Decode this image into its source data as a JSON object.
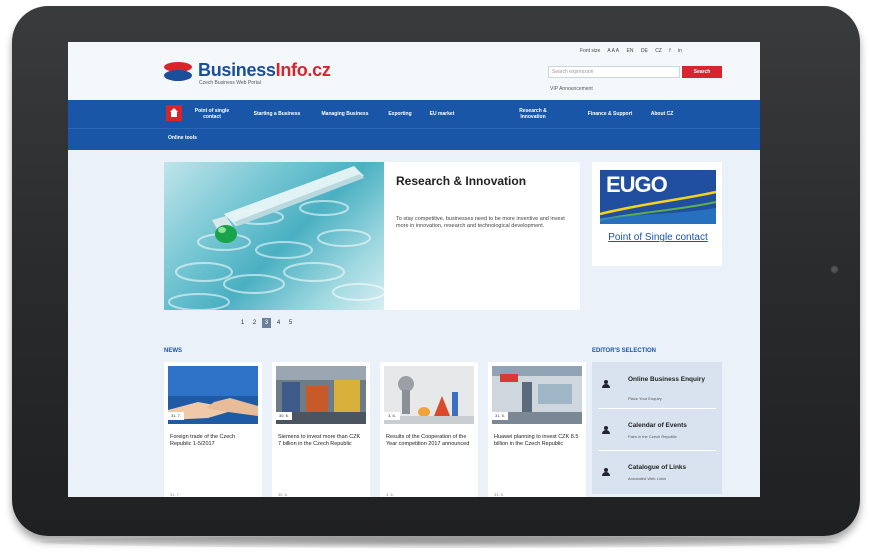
{
  "site": {
    "logo_main": "Business",
    "logo_accent": "Info.cz",
    "logo_tagline": "Czech Business Web Portal",
    "top_links": [
      "Font size",
      "A A A",
      "EN",
      "DE",
      "CZ",
      "f",
      "in"
    ],
    "search_placeholder": "Search expression",
    "search_button": "Search",
    "announcement": "VIP Announcement"
  },
  "nav": {
    "items": [
      {
        "label": "Point of single contact"
      },
      {
        "label": "Starting a Business"
      },
      {
        "label": "Managing Business"
      },
      {
        "label": "Exporting"
      },
      {
        "label": "EU market"
      },
      {
        "label": "Research & Innovation"
      },
      {
        "label": "Finance & Support"
      },
      {
        "label": "About CZ"
      }
    ],
    "sub_items": [
      {
        "label": "Online tools"
      }
    ]
  },
  "hero": {
    "title": "Research & Innovation",
    "text": "To stay competitive, businesses need to be more inventive and invest more in innovation, research and technological development.",
    "pages": [
      "1",
      "2",
      "3",
      "4",
      "5"
    ],
    "active_page": "3"
  },
  "eugo": {
    "wordmark": "EUGO",
    "link": "Point of Single contact"
  },
  "news": {
    "heading": "NEWS",
    "items": [
      {
        "date": "31. 7.",
        "title": "Foreign trade of the Czech Republic 1-5/2017",
        "foot": "31. 7."
      },
      {
        "date": "30. 6.",
        "title": "Siemens to invest more than CZK 7 billion in the Czech Republic",
        "foot": "30. 6."
      },
      {
        "date": "3. 6.",
        "title": "Results of the Cooperation of the Year competition 2017 announced",
        "foot": "3. 6."
      },
      {
        "date": "31. 5.",
        "title": "Huawei planning to invest CZK 8.5 billion in the Czech Republic",
        "foot": "31. 5."
      }
    ]
  },
  "editors": {
    "heading": "EDITOR'S SELECTION",
    "items": [
      {
        "title": "Online Business Enquiry",
        "sub": "Place Your Enquiry"
      },
      {
        "title": "Calendar of Events",
        "sub": "Fairs in the Czech Republic"
      },
      {
        "title": "Catalogue of Links",
        "sub": "Annotated Web Links"
      }
    ]
  },
  "colors": {
    "brand_blue": "#1a56a8",
    "brand_red": "#d9232d"
  }
}
